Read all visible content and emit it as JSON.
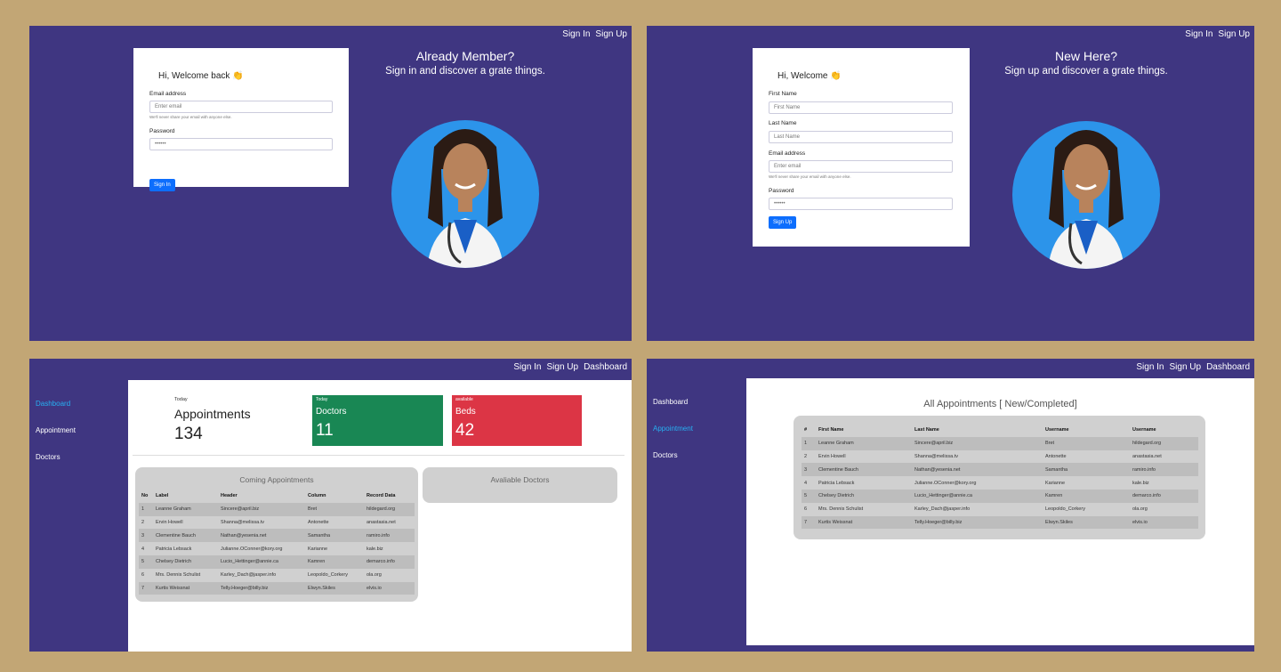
{
  "nav": {
    "sign_in": "Sign In",
    "sign_up": "Sign Up",
    "dashboard": "Dashboard"
  },
  "login": {
    "greeting": "Hi, Welcome back 👏",
    "email_label": "Email address",
    "email_placeholder": "Enter email",
    "email_help": "We'll never share your email with anyone else.",
    "password_label": "Password",
    "password_value": "••••••",
    "submit": "Sign In",
    "hero_title": "Already Member?",
    "hero_sub": "Sign in and discover a grate things."
  },
  "signup": {
    "greeting": "Hi, Welcome 👏",
    "first_label": "First Name",
    "first_placeholder": "First Name",
    "last_label": "Last Name",
    "last_placeholder": "Last Name",
    "email_label": "Email address",
    "email_placeholder": "Enter email",
    "email_help": "We'll never share your email with anyone else.",
    "password_label": "Password",
    "password_value": "••••••",
    "submit": "Sign Up",
    "hero_title": "New Here?",
    "hero_sub": "Sign up and discover a grate things."
  },
  "sidebar": {
    "items": [
      "Dashboard",
      "Appointment",
      "Doctors"
    ]
  },
  "dashboard": {
    "today_label": "Today",
    "appointments_title": "Appointments",
    "appointments_count": "134",
    "doctors": {
      "sub": "Today",
      "title": "Doctors",
      "value": "11",
      "color": "#198754"
    },
    "beds": {
      "sub": "available",
      "title": "Beds",
      "value": "42",
      "color": "#dc3545"
    },
    "coming_title": "Coming Appointments",
    "available_title": "Avaliable Doctors",
    "coming_headers": [
      "No",
      "Label",
      "Header",
      "Column",
      "Record Data"
    ]
  },
  "appointments_page": {
    "title": "All Appointments [ New/Completed]",
    "headers": [
      "#",
      "First Name",
      "Last Name",
      "Username",
      "Username"
    ]
  },
  "rows": [
    [
      "1",
      "Leanne Graham",
      "Sincere@april.biz",
      "Bret",
      "hildegard.org"
    ],
    [
      "2",
      "Ervin Howell",
      "Shanna@melissa.tv",
      "Antonette",
      "anastasia.net"
    ],
    [
      "3",
      "Clementine Bauch",
      "Nathan@yesenia.net",
      "Samantha",
      "ramiro.info"
    ],
    [
      "4",
      "Patricia Lebsack",
      "Julianne.OConner@kory.org",
      "Karianne",
      "kale.biz"
    ],
    [
      "5",
      "Chelsey Dietrich",
      "Lucio_Hettinger@annie.ca",
      "Kamren",
      "demarco.info"
    ],
    [
      "6",
      "Mrs. Dennis Schulist",
      "Karley_Dach@jasper.info",
      "Leopoldo_Corkery",
      "ola.org"
    ],
    [
      "7",
      "Kurtis Weissnat",
      "Telly.Hoeger@billy.biz",
      "Elwyn.Skiles",
      "elvis.io"
    ]
  ]
}
